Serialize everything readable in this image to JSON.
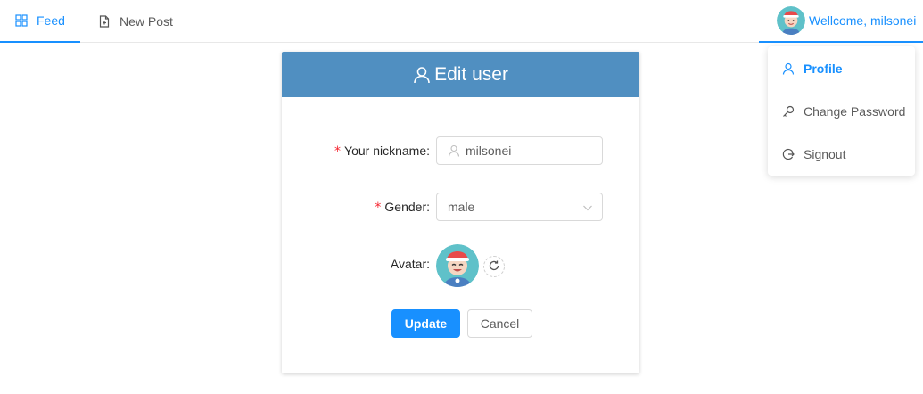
{
  "nav": {
    "feed_label": "Feed",
    "new_post_label": "New Post",
    "welcome_label": "Wellcome, milsonei"
  },
  "dropdown": {
    "profile_label": "Profile",
    "change_password_label": "Change Password",
    "signout_label": "Signout"
  },
  "card": {
    "title": "Edit user",
    "nickname_label": "Your nickname",
    "nickname_value": "milsonei",
    "gender_label": "Gender",
    "gender_value": "male",
    "avatar_label": "Avatar",
    "required_mark": "*",
    "label_colon": ":",
    "update_label": "Update",
    "cancel_label": "Cancel"
  },
  "icons": {
    "feed": "appstore-icon",
    "new_post": "file-add-icon",
    "profile": "user-icon",
    "change_password": "key-icon",
    "signout": "logout-icon",
    "nickname_prefix": "user-icon",
    "gender_arrow": "chevron-down-icon",
    "avatar_refresh": "reload-icon"
  },
  "colors": {
    "primary": "#1890ff",
    "card_header": "#508fc1",
    "required": "#f5222d"
  }
}
